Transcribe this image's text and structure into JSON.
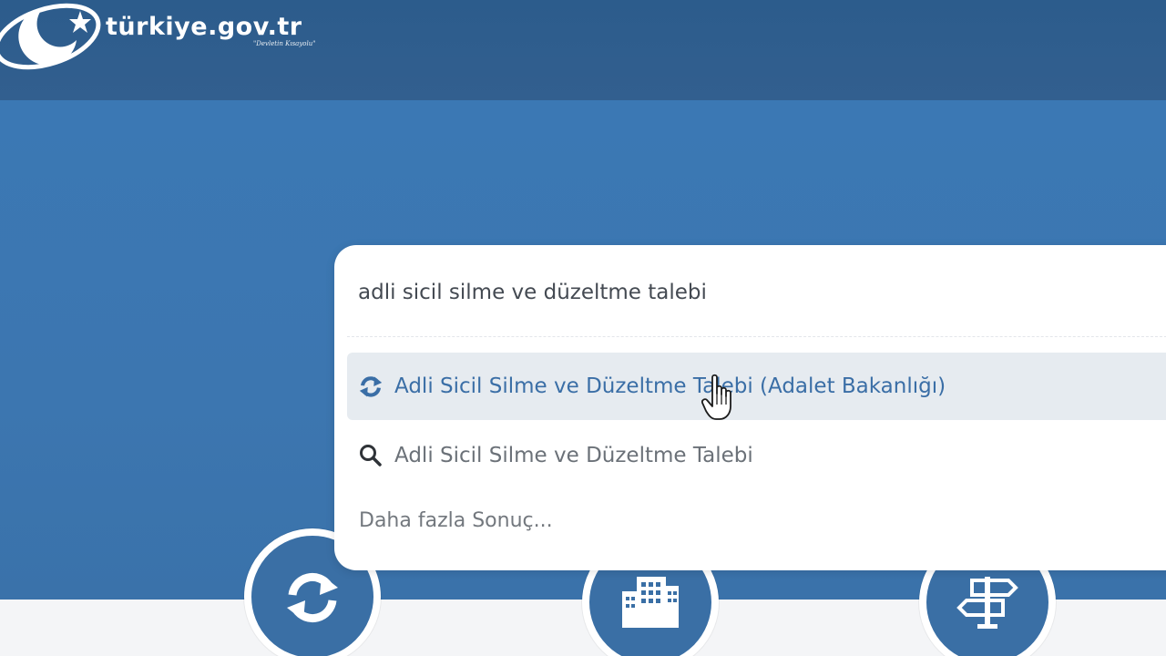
{
  "header": {
    "logo_text": "türkiye.gov.tr",
    "slogan": "\"Devletin Kısayolu\""
  },
  "search": {
    "value": "adli sicil silme ve düzeltme talebi",
    "results": [
      {
        "label": "Adli Sicil Silme ve Düzeltme Talebi (Adalet Bakanlığı)",
        "icon": "refresh-icon"
      },
      {
        "label": "Adli Sicil Silme ve Düzeltme Talebi",
        "icon": "search-icon"
      }
    ],
    "more_label": "Daha fazla Sonuç..."
  },
  "quick_links": [
    {
      "icon": "refresh-icon"
    },
    {
      "icon": "building-icon"
    },
    {
      "icon": "signpost-icon"
    }
  ],
  "colors": {
    "header_bg": "#2c5c8c",
    "hero_bg": "#3b78b4",
    "link_blue": "#3a6ea6"
  }
}
